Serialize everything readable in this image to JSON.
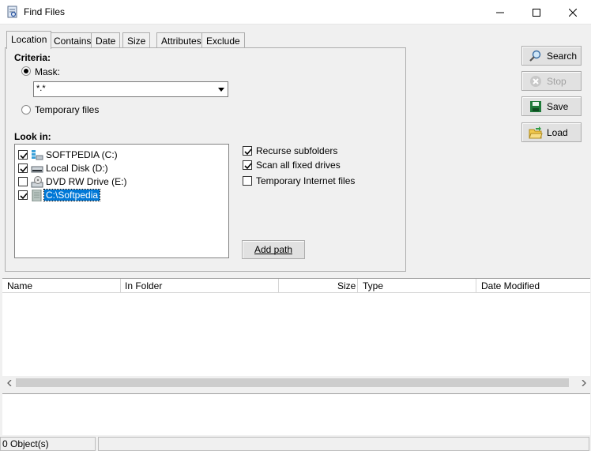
{
  "window": {
    "title": "Find Files",
    "controls": [
      "minimize",
      "maximize",
      "close"
    ]
  },
  "tabs": [
    {
      "label": "Location",
      "active": true
    },
    {
      "label": "Contains",
      "active": false
    },
    {
      "label": "Date",
      "active": false
    },
    {
      "label": "Size",
      "active": false
    },
    {
      "label": "Attributes",
      "active": false
    },
    {
      "label": "Exclude",
      "active": false
    }
  ],
  "location": {
    "criteria_label": "Criteria:",
    "mask_label": "Mask:",
    "mask_value": "*.*",
    "mask_selected": true,
    "temp_files_label": "Temporary files",
    "temp_files_selected": false,
    "look_in_label": "Look in:",
    "drives": [
      {
        "label": "SOFTPEDIA (C:)",
        "checked": true,
        "icon": "network-drive-icon"
      },
      {
        "label": "Local Disk (D:)",
        "checked": true,
        "icon": "hard-drive-icon"
      },
      {
        "label": "DVD RW Drive (E:)",
        "checked": false,
        "icon": "dvd-drive-icon"
      },
      {
        "label": "C:\\Softpedia",
        "checked": true,
        "icon": "folder-icon",
        "selected": true
      }
    ],
    "options": [
      {
        "label": "Recurse subfolders",
        "checked": true
      },
      {
        "label": "Scan all fixed drives",
        "checked": true
      },
      {
        "label": "Temporary Internet files",
        "checked": false
      }
    ],
    "add_path_label": "Add path"
  },
  "actions": {
    "search": "Search",
    "stop": "Stop",
    "save": "Save",
    "load": "Load"
  },
  "results": {
    "columns": [
      "Name",
      "In Folder",
      "Size",
      "Type",
      "Date Modified"
    ],
    "rows": []
  },
  "status": {
    "objects": "0 Object(s)"
  },
  "colors": {
    "selection": "#0078d7",
    "window_bg": "#f0f0f0"
  }
}
